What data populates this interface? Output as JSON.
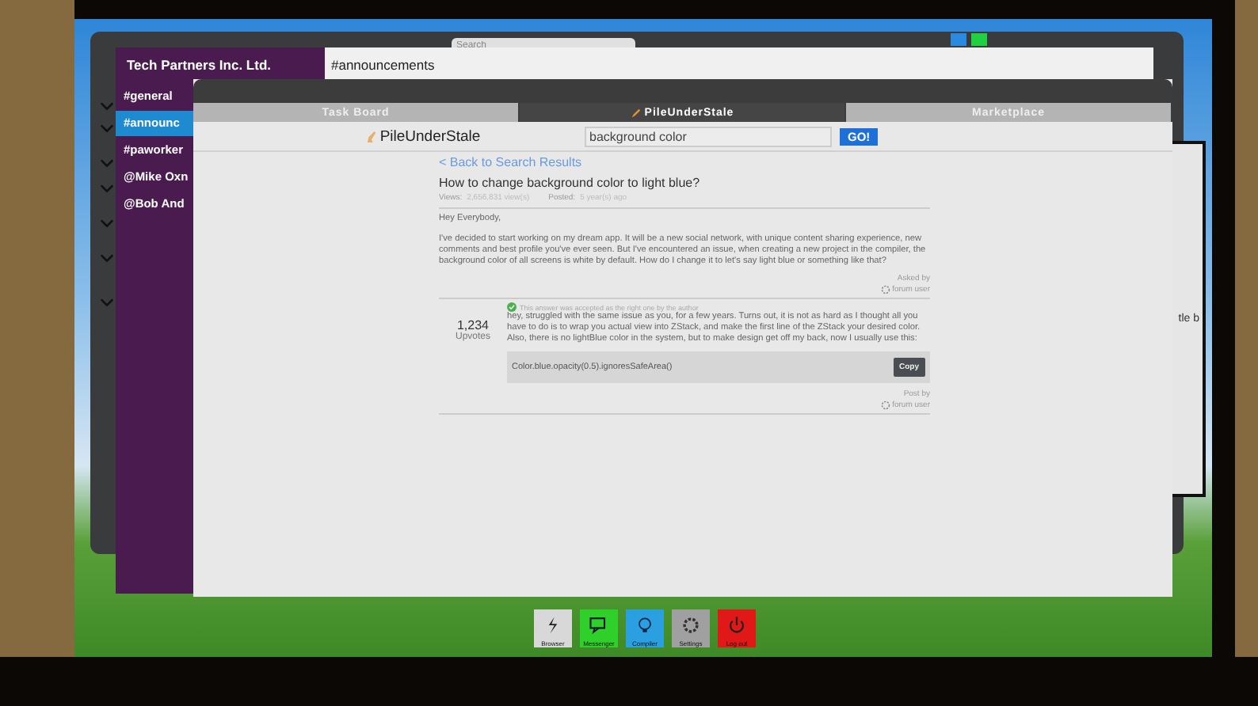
{
  "back_window": {
    "search": {
      "placeholder": "Search"
    }
  },
  "messenger": {
    "workspace": "Tech Partners Inc. Ltd.",
    "channel_title": "#announcements",
    "channels": [
      {
        "name": "#general",
        "selected": false
      },
      {
        "name": "#announc",
        "selected": true
      },
      {
        "name": "#paworker",
        "selected": false
      },
      {
        "name": "@Mike Oxn",
        "selected": false
      },
      {
        "name": "@Bob And",
        "selected": false
      }
    ]
  },
  "browser": {
    "tabs": [
      {
        "label": "Task Board",
        "selected": false
      },
      {
        "label": "PileUnderStale",
        "selected": true
      },
      {
        "label": "Marketplace",
        "selected": false
      }
    ],
    "site_name": "PileUnderStale",
    "search": {
      "value": "background color"
    },
    "search_button": "GO!",
    "back_link": "< Back to Search Results",
    "question": {
      "title": "How to change background color to light blue?",
      "views_label": "Views:",
      "views": "2,656,831 view(s)",
      "posted_label": "Posted:",
      "posted": "5 year(s) ago",
      "greeting": "Hey Everybody,",
      "body": "I've decided to start working on my dream app. It will be a new social network, with unique content sharing experience, new comments and best profile you've ever seen. But I've encountered an issue, when creating a new project in the compiler, the background color of all screens is white by default. How do I change it to let's say light blue or something like that?",
      "asked_by": "Asked by",
      "author": "forum user"
    },
    "answer": {
      "votes": "1,234",
      "votes_label": "Upvotes",
      "accepted": true,
      "accepted_note": "This answer was accepted as the right one by the author",
      "paragraphs": [
        "hey, struggled with the same issue as you, for a few years. Turns out, it is not as hard as I thought all you have to do is to wrap you actual view into ZStack, and make the first line of the ZStack your desired color.",
        "Also, there is no lightBlue color in the system, but to make design get off my back, now I usually use this:"
      ],
      "code": "Color.blue.opacity(0.5).ignoresSafeArea()",
      "copy_button": "Copy",
      "posted_by": "Post by",
      "author": "forum user"
    }
  },
  "side_window": {
    "text": "tle b"
  },
  "dock": [
    {
      "label": "Browser",
      "kind": "browser"
    },
    {
      "label": "Messenger",
      "kind": "messenger"
    },
    {
      "label": "Compiler",
      "kind": "compiler"
    },
    {
      "label": "Settings",
      "kind": "settings"
    },
    {
      "label": "Log out",
      "kind": "logout"
    }
  ]
}
